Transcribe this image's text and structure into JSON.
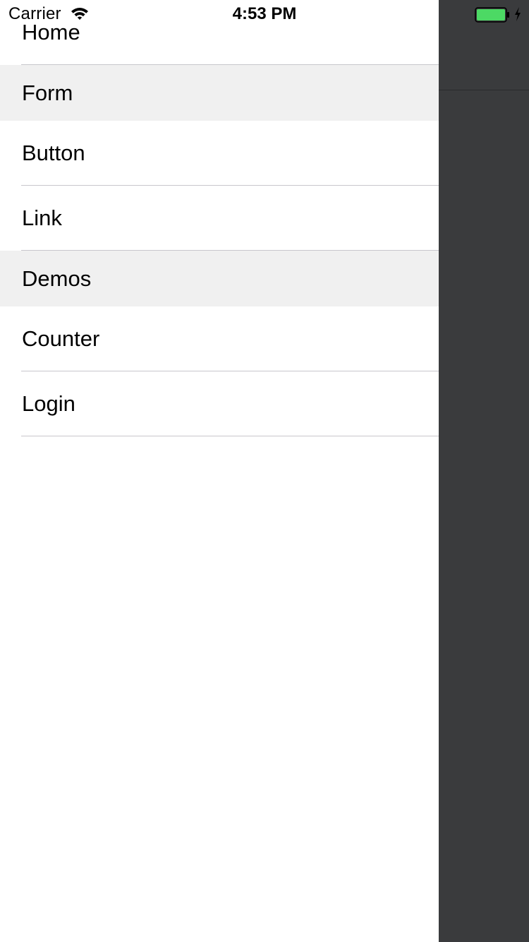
{
  "status_bar": {
    "carrier": "Carrier",
    "time": "4:53 PM",
    "battery_color": "#4cd964",
    "wifi_icon": "wifi-icon",
    "battery_icon": "battery-icon",
    "charging_icon": "bolt-icon"
  },
  "menu": {
    "items": [
      {
        "label": "Home",
        "type": "item"
      },
      {
        "label": "Form",
        "type": "section"
      },
      {
        "label": "Button",
        "type": "item"
      },
      {
        "label": "Link",
        "type": "item"
      },
      {
        "label": "Demos",
        "type": "section"
      },
      {
        "label": "Counter",
        "type": "item"
      },
      {
        "label": "Login",
        "type": "item"
      }
    ]
  },
  "colors": {
    "section_background": "#f0f0f0",
    "separator": "#c8c7cc",
    "overlay": "#3a3b3d"
  }
}
